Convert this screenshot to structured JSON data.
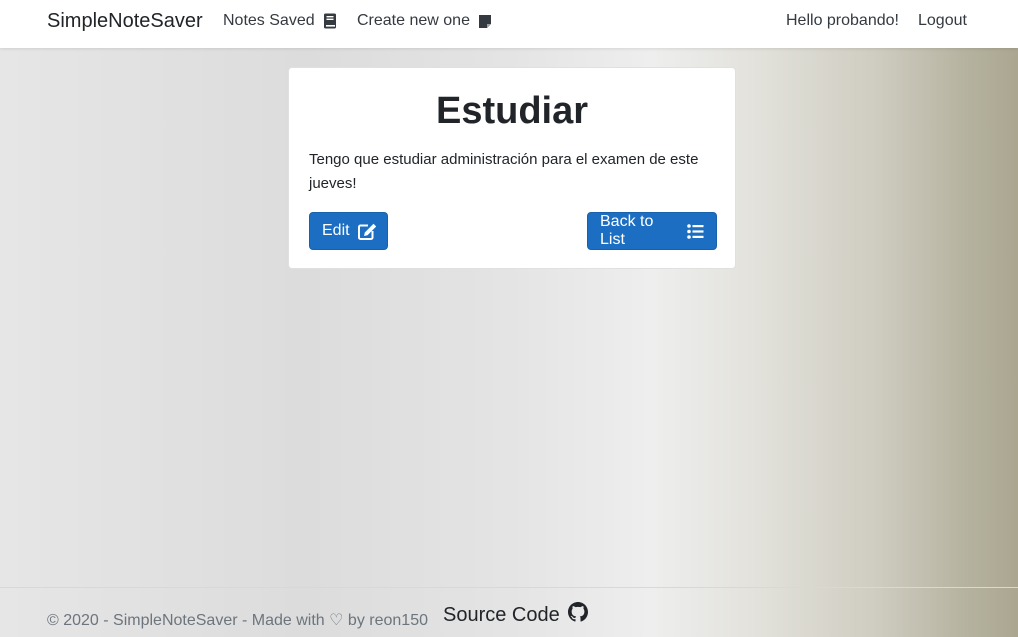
{
  "navbar": {
    "brand": "SimpleNoteSaver",
    "notes_saved": {
      "label": "Notes Saved",
      "icon": "book-icon"
    },
    "create_new": {
      "label": "Create new one",
      "icon": "sticky-note-icon"
    },
    "greeting": "Hello probando!",
    "logout": "Logout"
  },
  "note": {
    "title": "Estudiar",
    "content": "Tengo que estudiar administración para el examen de este jueves!",
    "edit_button": {
      "label": "Edit",
      "icon": "edit-icon"
    },
    "back_button": {
      "label": "Back to List",
      "icon": "list-icon"
    }
  },
  "footer": {
    "copyright": "© 2020 - SimpleNoteSaver - Made with ♡ by reon150",
    "source_code": {
      "label": "Source Code",
      "icon": "github-icon"
    }
  },
  "colors": {
    "primary_button": "#1b6ec2",
    "navbar_bg": "#ffffff",
    "text": "#212529",
    "muted_text": "#6c757d"
  }
}
